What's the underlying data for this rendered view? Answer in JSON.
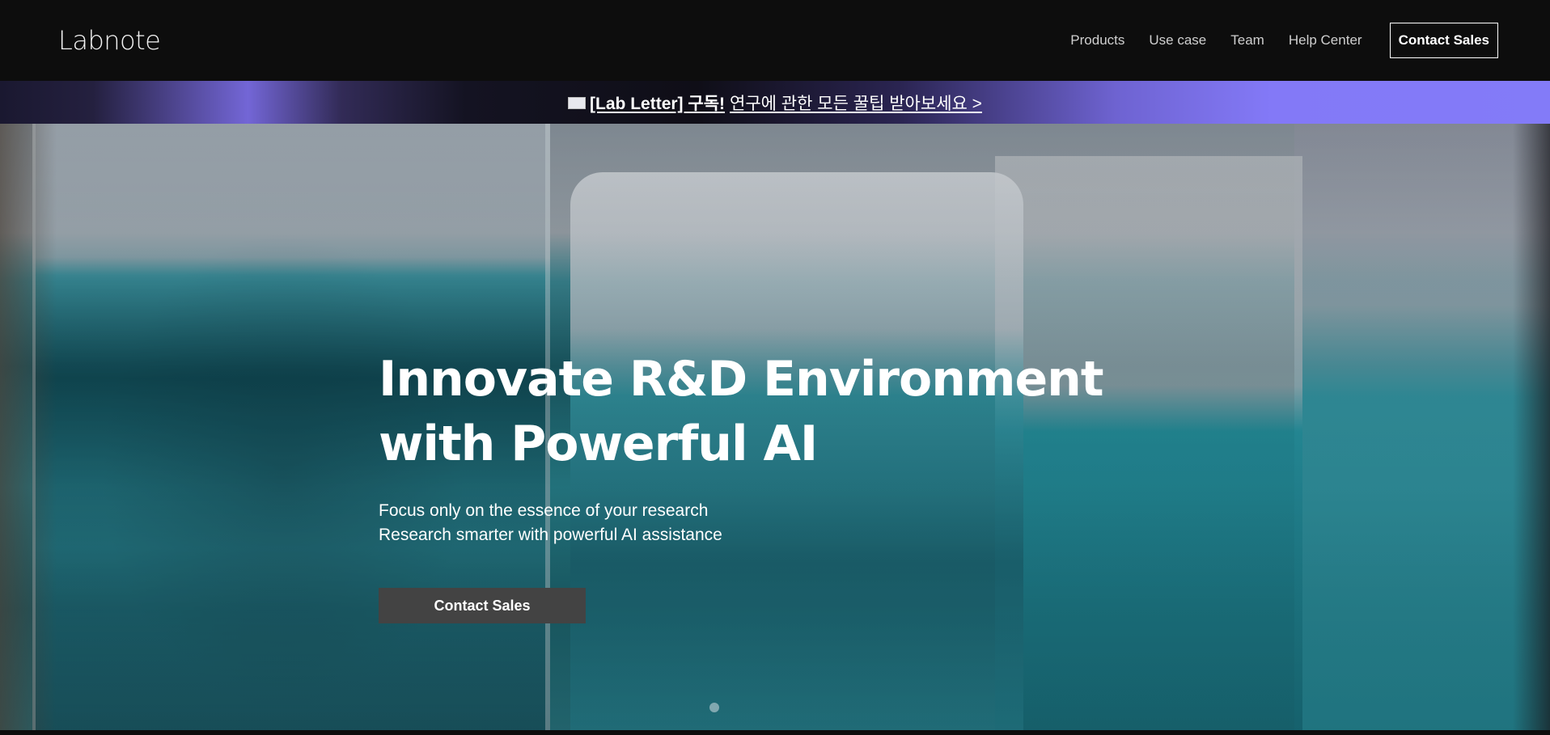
{
  "header": {
    "logo": "Labnote",
    "nav": [
      "Products",
      "Use case",
      "Team",
      "Help Center"
    ],
    "cta": "Contact Sales"
  },
  "banner": {
    "icon": "mail-icon",
    "strong": "[Lab Letter] 구독!",
    "text": "연구에 관한 모든 꿀팁 받아보세요 >"
  },
  "hero": {
    "title_line1": "Innovate R&D Environment",
    "title_line2": "with Powerful AI",
    "subtitle_line1": "Focus only on the essence of your research",
    "subtitle_line2": "Research smarter with powerful AI assistance",
    "cta": "Contact Sales"
  },
  "colors": {
    "header_bg": "#0d0d0d",
    "banner_accent": "#837bf8",
    "hero_cta_bg": "#434343"
  }
}
